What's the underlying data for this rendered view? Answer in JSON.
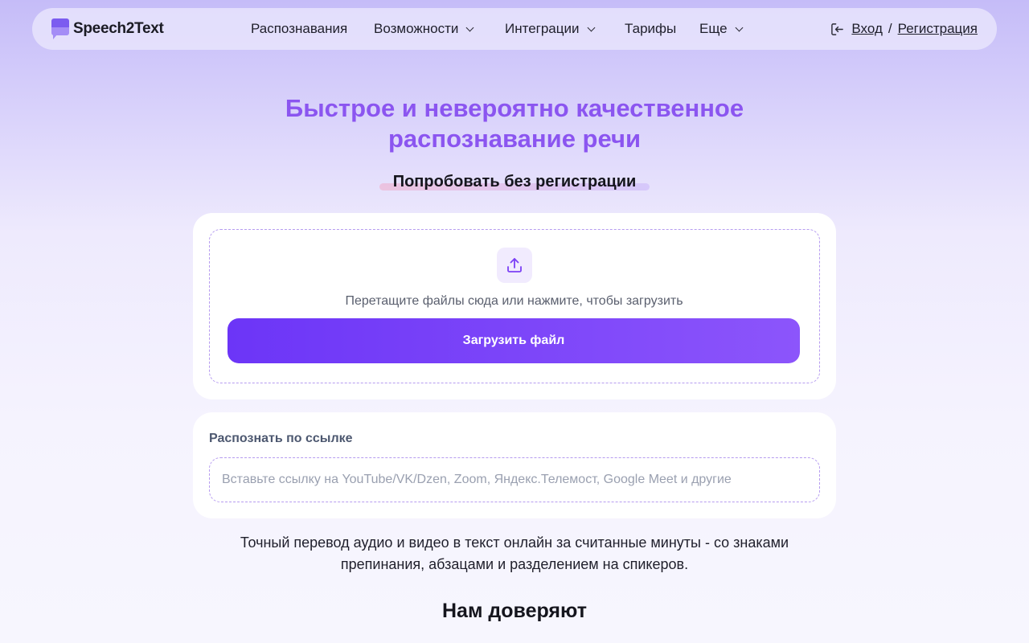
{
  "header": {
    "logo_text": "Speech2Text",
    "nav": [
      {
        "label": "Распознавания",
        "has_dropdown": false
      },
      {
        "label": "Возможности",
        "has_dropdown": true
      },
      {
        "label": "Интеграции",
        "has_dropdown": true
      },
      {
        "label": "Тарифы",
        "has_dropdown": false
      },
      {
        "label": "Еще",
        "has_dropdown": true
      }
    ],
    "login_label": "Вход",
    "separator": "/",
    "register_label": "Регистрация",
    "login_icon": "login-icon"
  },
  "hero": {
    "title_line1": "Быстрое и невероятно качественное",
    "title_line2": "распознавание речи",
    "try_label": "Попробовать без регистрации"
  },
  "upload": {
    "icon": "upload-icon",
    "drop_text": "Перетащите файлы сюда или нажмите, чтобы загрузить",
    "button_label": "Загрузить файл"
  },
  "link": {
    "label": "Распознать по ссылке",
    "placeholder": "Вставьте ссылку на YouTube/VK/Dzen, Zoom, Яндекс.Телемост, Google Meet и другие",
    "value": ""
  },
  "description_line1": "Точный перевод аудио и видео в текст онлайн за считанные минуты - со знаками",
  "description_line2": "препинания, абзацами и разделением на спикеров.",
  "trust_heading": "Нам доверяют",
  "colors": {
    "accent": "#8b55f0",
    "button_gradient_start": "#6c35f7",
    "button_gradient_end": "#8c55fb",
    "dashed_border": "#b69cf0"
  }
}
